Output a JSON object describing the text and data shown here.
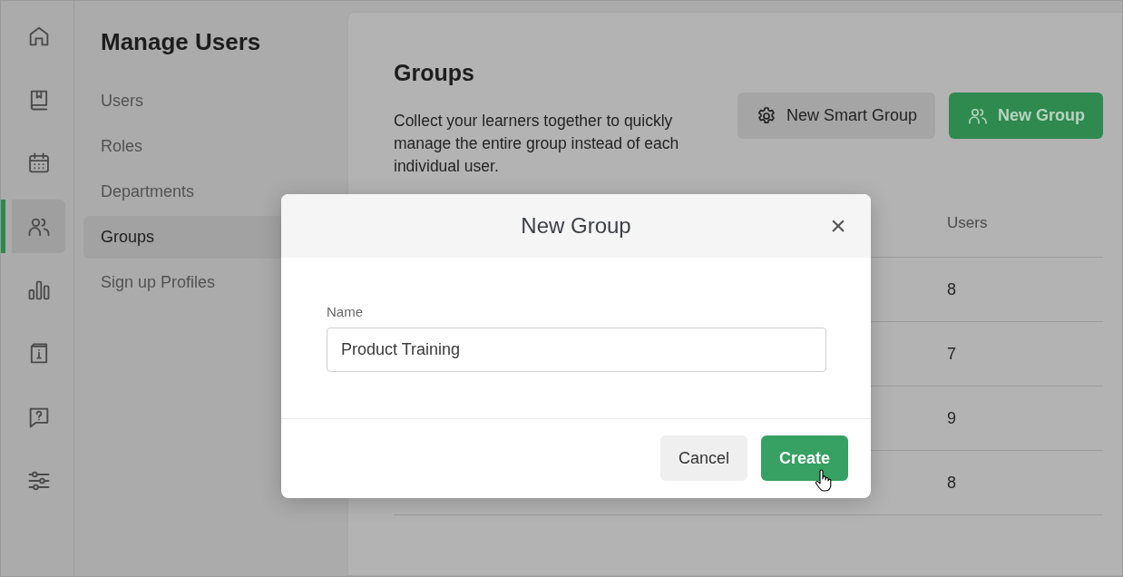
{
  "rail": {
    "items": [
      {
        "selected": false
      },
      {
        "selected": false
      },
      {
        "selected": false
      },
      {
        "selected": true
      },
      {
        "selected": false
      },
      {
        "selected": false
      },
      {
        "selected": false
      },
      {
        "selected": false
      }
    ]
  },
  "sidebar": {
    "title": "Manage Users",
    "items": [
      {
        "label": "Users",
        "selected": false
      },
      {
        "label": "Roles",
        "selected": false
      },
      {
        "label": "Departments",
        "selected": false
      },
      {
        "label": "Groups",
        "selected": true
      },
      {
        "label": "Sign up Profiles",
        "selected": false
      }
    ]
  },
  "main": {
    "title": "Groups",
    "description": "Collect your learners together to quickly manage the entire group instead of each individual user.",
    "buttons": [
      {
        "label": "New Smart Group",
        "kind": "secondary"
      },
      {
        "label": "New Group",
        "kind": "primary"
      }
    ],
    "table": {
      "users_column": "Users",
      "rows": [
        {
          "users": "8"
        },
        {
          "users": "7"
        },
        {
          "users": "9"
        },
        {
          "users": "8"
        }
      ]
    }
  },
  "dialog": {
    "title": "New Group",
    "close": "×",
    "field": {
      "label": "Name",
      "value": "Product Training"
    },
    "buttons": [
      {
        "label": "Cancel",
        "kind": "secondary"
      },
      {
        "label": "Create",
        "kind": "primary"
      }
    ]
  }
}
